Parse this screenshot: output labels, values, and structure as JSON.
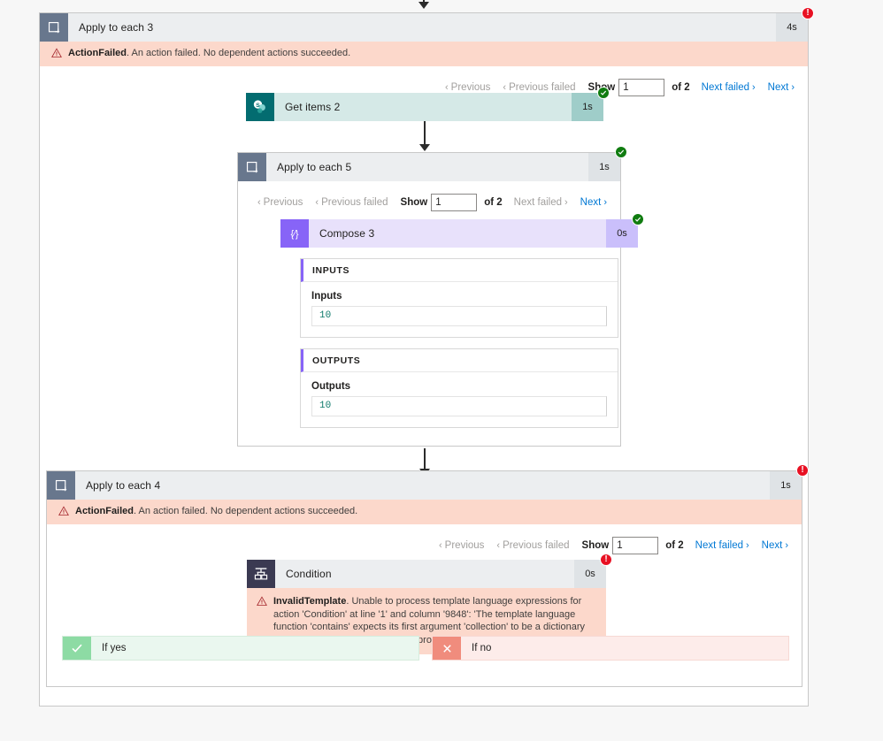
{
  "top_connector": {
    "icon": "down-arrow-icon"
  },
  "apply_to_each_3": {
    "title": "Apply to each 3",
    "icon": "loop-icon",
    "duration": "4s",
    "status": "failed",
    "status_icon": "error-badge-icon",
    "error": {
      "icon": "warning-icon",
      "code": "ActionFailed",
      "message": ". An action failed. No dependent actions succeeded."
    },
    "pager": {
      "previous": "Previous",
      "previous_failed": "Previous failed",
      "show_label": "Show",
      "page_value": "1",
      "of_label": "of 2",
      "next_failed": "Next failed",
      "next": "Next",
      "prev_chevron": "‹",
      "next_chevron": "›"
    }
  },
  "get_items_2": {
    "title": "Get items 2",
    "icon": "sharepoint-icon",
    "duration": "1s",
    "status": "succeeded",
    "status_icon": "success-badge-icon"
  },
  "apply_to_each_5": {
    "title": "Apply to each 5",
    "icon": "loop-icon",
    "duration": "1s",
    "status": "succeeded",
    "status_icon": "success-badge-icon",
    "pager": {
      "previous": "Previous",
      "previous_failed": "Previous failed",
      "show_label": "Show",
      "page_value": "1",
      "of_label": "of 2",
      "next_failed": "Next failed",
      "next": "Next",
      "prev_chevron": "‹",
      "next_chevron": "›"
    }
  },
  "compose_3": {
    "title": "Compose 3",
    "icon": "compose-icon",
    "duration": "0s",
    "status": "succeeded",
    "status_icon": "success-badge-icon",
    "inputs_section": {
      "header": "INPUTS",
      "label": "Inputs",
      "value": "10"
    },
    "outputs_section": {
      "header": "OUTPUTS",
      "label": "Outputs",
      "value": "10"
    }
  },
  "apply_to_each_4": {
    "title": "Apply to each 4",
    "icon": "loop-icon",
    "duration": "1s",
    "status": "failed",
    "status_icon": "error-badge-icon",
    "error": {
      "icon": "warning-icon",
      "code": "ActionFailed",
      "message": ". An action failed. No dependent actions succeeded."
    },
    "pager": {
      "previous": "Previous",
      "previous_failed": "Previous failed",
      "show_label": "Show",
      "page_value": "1",
      "of_label": "of 2",
      "next_failed": "Next failed",
      "next": "Next",
      "prev_chevron": "‹",
      "next_chevron": "›"
    }
  },
  "condition": {
    "title": "Condition",
    "icon": "condition-icon",
    "duration": "0s",
    "status": "failed",
    "status_icon": "error-badge-icon",
    "error": {
      "icon": "warning-icon",
      "code": "InvalidTemplate",
      "message": ". Unable to process template language expressions for action 'Condition' at line '1' and column '9848': 'The template language function 'contains' expects its first argument 'collection' to be a dictionary (object), an array or a string. The provided value is of type 'Float'.'."
    },
    "branch_yes": {
      "label": "If yes",
      "icon": "check-icon"
    },
    "branch_no": {
      "label": "If no",
      "icon": "cross-icon"
    }
  },
  "colors": {
    "page_background": "#f7f7f7",
    "card_background": "#ffffff",
    "loop_header": "#eceef0",
    "loop_icon_bg": "#68778d",
    "sharepoint_header": "#d5e9e7",
    "sharepoint_icon_bg": "#036c70",
    "compose_header": "#e8e1fb",
    "compose_icon_bg": "#8764f7",
    "condition_icon_bg": "#3b3a52",
    "error_strip": "#fcd8cb",
    "link": "#0078d4",
    "success_badge": "#107c10",
    "error_badge": "#e81123",
    "code_text": "#0f7b6c",
    "branch_yes_bg": "#eaf7ef",
    "branch_no_bg": "#fdecea"
  }
}
